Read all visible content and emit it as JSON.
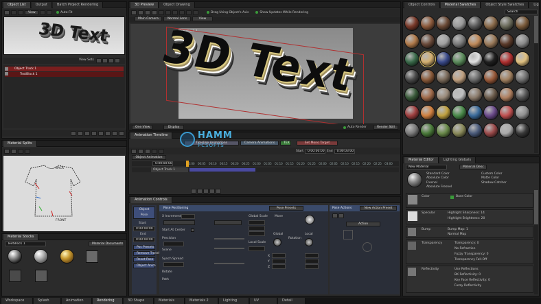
{
  "left_top": {
    "tabs": [
      "Object List",
      "Output",
      "Batch Project Rendering"
    ],
    "auto_fit_label": "Auto-Fit",
    "view_label": "View",
    "preview_text": "3D Text",
    "view_sets_label": "View Sets",
    "rows": [
      "Object Track 1",
      "TextBlock 1"
    ]
  },
  "splits": {
    "title": "Material Splits",
    "labels": [
      "BACK",
      "FRONT"
    ]
  },
  "mat_stock": {
    "title": "Material Stocks",
    "field": "TextBlock 1",
    "dropdown": "Material Documents"
  },
  "preview": {
    "tabs": [
      "3D Preview",
      "Object Drawing"
    ],
    "drag_label": "Drag Using Object's Axis",
    "updates_label": "Show Updates While Rendering",
    "mode_buttons": [
      "Main Camera",
      "Normal Lens",
      "View"
    ],
    "object_label": "TextBlock 1",
    "text": "3D Text",
    "bottom_left": [
      "One View",
      "Display"
    ],
    "auto_render_label": "Auto Render",
    "render_btn": "Render Still"
  },
  "timeline": {
    "title": "Animation Timeline",
    "tab_left": "Timeline Animations",
    "tab_right": "Camera Animations",
    "fps_badge": "TEX",
    "anim_target": "Set Mono Target",
    "start_label": "Start",
    "start_val": "0:00:00:00",
    "end_label": "End",
    "end_val": "0:00:03:00",
    "dropdown": "Object Animation",
    "time_val": "0:00:00:00",
    "ticks": [
      "00:00",
      "00:05",
      "00:10",
      "00:15",
      "00:20",
      "00:25",
      "01:00",
      "01:05",
      "01:10",
      "01:15",
      "01:20",
      "01:25",
      "02:00",
      "02:05",
      "02:10",
      "02:15",
      "02:20",
      "02:25",
      "03:00"
    ],
    "track_name": "Object Track 1"
  },
  "controls": {
    "title": "Animation Controls",
    "sidebar": [
      "Object Pose",
      "Start",
      "End",
      "Pos Presets",
      "Remove Transform",
      "Reset Pose",
      "Object Anim"
    ],
    "sidebar_values": [
      "0:00:00:00",
      "0:00:00:00"
    ],
    "pose_title": "Pose Positioning",
    "pose_presets": "Pose Presets",
    "fields": [
      "X Increment",
      "Start At Center",
      "Precision",
      "Scene",
      "Synch Spread",
      "Rotate",
      "Path"
    ],
    "scale_label": "Global Scale",
    "local_scale_label": "Local Scale",
    "move_label": "Move",
    "global_label": "Global",
    "rotation_label": "Rotation",
    "local_label": "Local",
    "pose_actions": "Pose Actions",
    "new_action": "New Action Preset",
    "action_btn": "Action",
    "x": "X",
    "y": "Y",
    "z": "Z"
  },
  "materials": {
    "tabs": [
      "Object Controls",
      "Material Swatches",
      "Object Style Swatches",
      "Lighting Rigs"
    ],
    "search": "Search",
    "swatches": [
      "#7a3a2a",
      "#8c5a3c",
      "#6b4a36",
      "#9a9a9a",
      "#5a5a5a",
      "#8a6a4a",
      "#6a6a5a",
      "#7a5a3a",
      "#b07a4a",
      "#6a4a3a",
      "#a0a0a0",
      "#7a7a7a",
      "#c08a5a",
      "#9a7a5a",
      "#5a3a2a",
      "#8a8a8a",
      "#3a6a4a",
      "#d4b070",
      "#3a4a8a",
      "#5a8a5a",
      "#e0e0e0",
      "#202020",
      "#b03030",
      "#e0c080",
      "#4a4a4a",
      "#8a5a3a",
      "#7a6a5a",
      "#c0a080",
      "#6a6a6a",
      "#9a5a3a",
      "#a08060",
      "#707070",
      "#3a5a3a",
      "#a06a4a",
      "#9a8a7a",
      "#c0c0c0",
      "#8a7a6a",
      "#6a5a4a",
      "#b08060",
      "#555555",
      "#a04040",
      "#d08040",
      "#c0a040",
      "#4a8a4a",
      "#3a6a9a",
      "#6a4a8a",
      "#c05050",
      "#909090",
      "#7a7a7a",
      "#4a7a3a",
      "#6a8a4a",
      "#8a8a5a",
      "#4a5a7a",
      "#9a4a4a",
      "#aaaaaa",
      "#3a3a3a"
    ]
  },
  "editor": {
    "tabs": [
      "Material Editor",
      "Lighting Globals"
    ],
    "field": "New Material",
    "dropdown": "Material Desc",
    "options": [
      "Standard Color",
      "Custom Color",
      "Absolute Color",
      "Matte Color",
      "Fresnel",
      "Shadow Catcher",
      "Absolute Fresnel"
    ],
    "sections": [
      "Color",
      "Specular",
      "Bump",
      "Transparency",
      "Reflectivity"
    ],
    "base_color": "Base Color",
    "spec_lines": [
      "Highlight Sharpness: 14",
      "Highlight Brightness: 20"
    ],
    "bump_lines": [
      "Bump Map: 1",
      "Normal Map"
    ],
    "trans_lines": [
      "Transparency: 0",
      "No Refraction",
      "Fuzzy Transparency: 0",
      "Transparency Fall-Off"
    ],
    "refl_lines": [
      "Use Reflections",
      "BK Reflectivity: 0",
      "Key Face Reflectivity: 0",
      "Fuzzy Reflectivity"
    ]
  },
  "bottom_tabs": [
    "Workspace",
    "Splash",
    "Animation",
    "Rendering",
    "3D Shape",
    "Materials",
    "Materials 2",
    "Lighting",
    "UV",
    "Detail"
  ],
  "watermark": {
    "name": "HAMM",
    "sub": "PCSOFTS"
  }
}
